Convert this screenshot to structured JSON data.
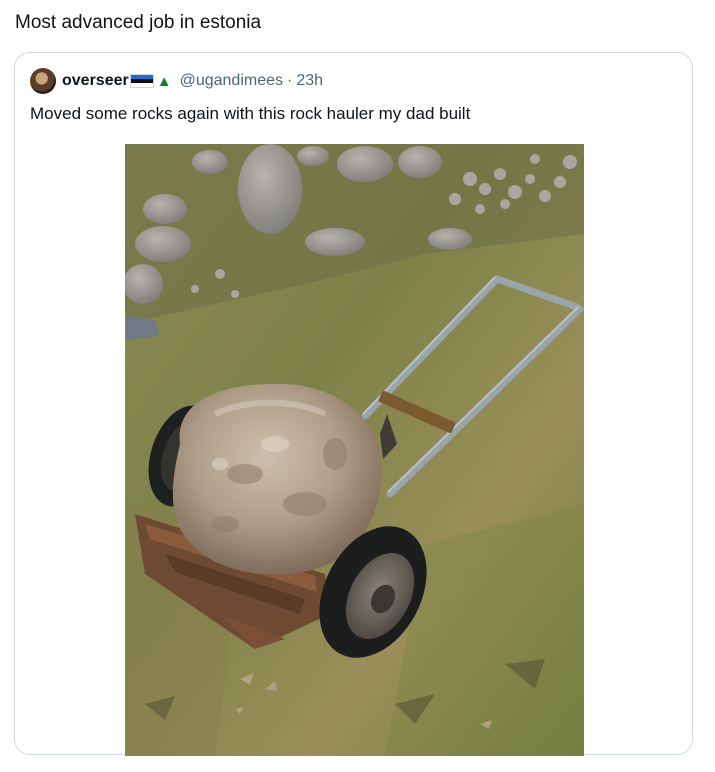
{
  "post": {
    "text": "Most advanced job in estonia"
  },
  "quote": {
    "display_name": "overseer",
    "flag_icon": "estonia-flag-icon",
    "emoji_icon": "evergreen-tree-icon",
    "handle": "@ugandimees",
    "separator": "·",
    "time": "23h",
    "text": "Moved some rocks again with this rock hauler my dad built",
    "media": "photo of a large boulder loaded on a homemade two-wheeled metal rock hauler in grass"
  },
  "colors": {
    "text_primary": "#0f1419",
    "text_secondary": "#536471",
    "border": "#cfd9de"
  }
}
